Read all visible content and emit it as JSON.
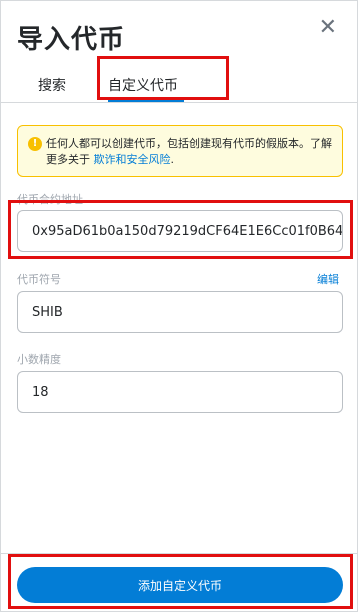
{
  "header": {
    "title": "导入代币",
    "close_icon": "close-icon",
    "close_glyph": "✕"
  },
  "tabs": [
    {
      "label": "搜索",
      "active": false
    },
    {
      "label": "自定义代币",
      "active": true
    }
  ],
  "alert": {
    "icon": "info-icon",
    "icon_glyph": "!",
    "text": "任何人都可以创建代币，包括创建现有代币的假版本。了解更多关于 ",
    "link": "欺诈和安全风险",
    "suffix": "."
  },
  "fields": {
    "address": {
      "label": "代币合约地址",
      "value": "0x95aD61b0a150d79219dCF64E1E6Cc01f0B64"
    },
    "symbol": {
      "label": "代币符号",
      "value": "SHIB",
      "edit": "编辑"
    },
    "decimals": {
      "label": "小数精度",
      "value": "18"
    }
  },
  "footer": {
    "add_button": "添加自定义代币"
  },
  "colors": {
    "accent": "#037dd6",
    "warning_bg": "#fefcde",
    "warning_border": "#f8c000",
    "highlight": "#e10f0f"
  }
}
